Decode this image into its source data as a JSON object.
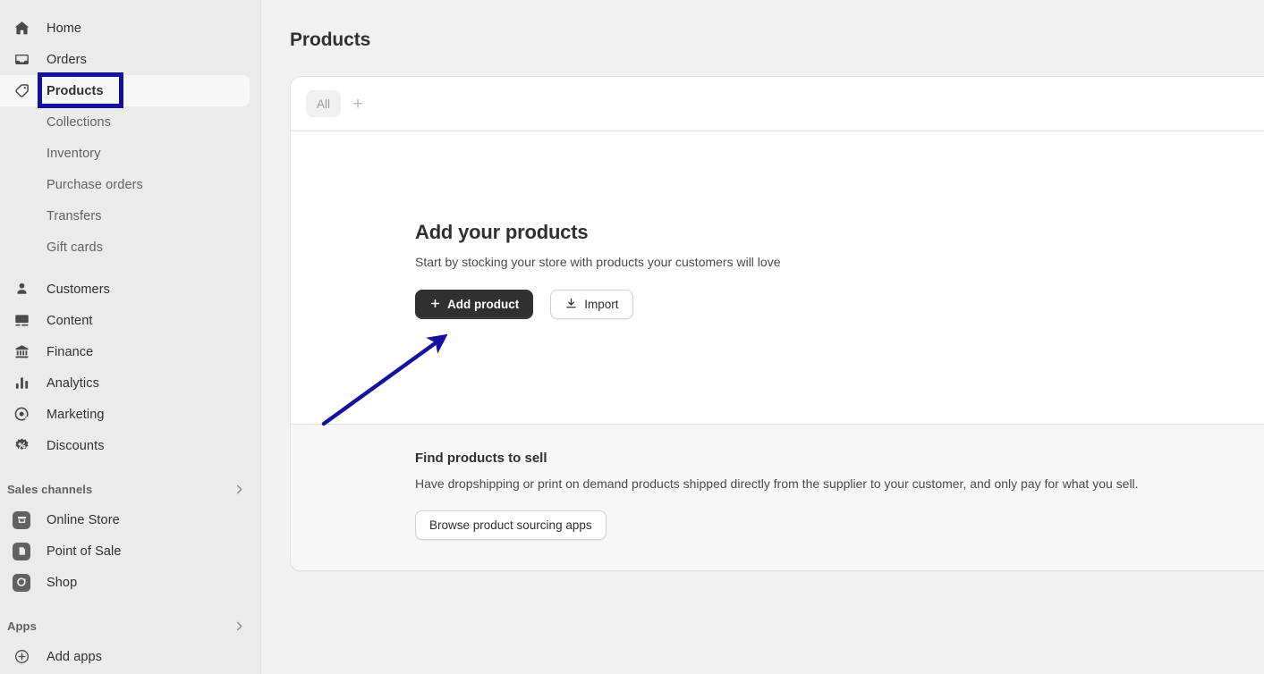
{
  "sidebar": {
    "items": [
      {
        "label": "Home",
        "icon": "home-icon",
        "type": "main",
        "active": false
      },
      {
        "label": "Orders",
        "icon": "orders-inbox-icon",
        "type": "main",
        "active": false
      },
      {
        "label": "Products",
        "icon": "product-tag-icon",
        "type": "main",
        "active": true
      },
      {
        "label": "Collections",
        "icon": "",
        "type": "sub",
        "active": false
      },
      {
        "label": "Inventory",
        "icon": "",
        "type": "sub",
        "active": false
      },
      {
        "label": "Purchase orders",
        "icon": "",
        "type": "sub",
        "active": false
      },
      {
        "label": "Transfers",
        "icon": "",
        "type": "sub",
        "active": false
      },
      {
        "label": "Gift cards",
        "icon": "",
        "type": "sub",
        "active": false
      },
      {
        "label": "Customers",
        "icon": "customer-person-icon",
        "type": "main",
        "active": false
      },
      {
        "label": "Content",
        "icon": "content-image-icon",
        "type": "main",
        "active": false
      },
      {
        "label": "Finance",
        "icon": "finance-bank-icon",
        "type": "main",
        "active": false
      },
      {
        "label": "Analytics",
        "icon": "analytics-bar-chart-icon",
        "type": "main",
        "active": false
      },
      {
        "label": "Marketing",
        "icon": "marketing-target-icon",
        "type": "main",
        "active": false
      },
      {
        "label": "Discounts",
        "icon": "discount-badge-icon",
        "type": "main",
        "active": false
      }
    ],
    "sales_channels": {
      "title": "Sales channels",
      "chevron": "chevron-right-icon",
      "items": [
        {
          "label": "Online Store",
          "icon": "online-store-icon"
        },
        {
          "label": "Point of Sale",
          "icon": "point-of-sale-icon"
        },
        {
          "label": "Shop",
          "icon": "shop-icon"
        }
      ]
    },
    "apps": {
      "title": "Apps",
      "chevron": "chevron-right-icon",
      "items": [
        {
          "label": "Add apps",
          "icon": "plus-circle-icon"
        }
      ]
    }
  },
  "main": {
    "page_title": "Products",
    "tabs": [
      {
        "label": "All",
        "selected": true
      }
    ],
    "tab_add_label": "+",
    "empty_state": {
      "title": "Add your products",
      "subtitle": "Start by stocking your store with products your customers will love",
      "primary_button": "Add product",
      "primary_button_icon": "plus-icon",
      "secondary_button": "Import",
      "secondary_button_icon": "download-icon"
    },
    "find_products": {
      "title": "Find products to sell",
      "description": "Have dropshipping or print on demand products shipped directly from the supplier to your customer, and only pay for what you sell.",
      "button": "Browse product sourcing apps"
    }
  },
  "annotations": {
    "highlight_color": "#14119E",
    "arrow_color": "#14119E",
    "highlight_target": "Products",
    "arrow_target": "Add product"
  }
}
